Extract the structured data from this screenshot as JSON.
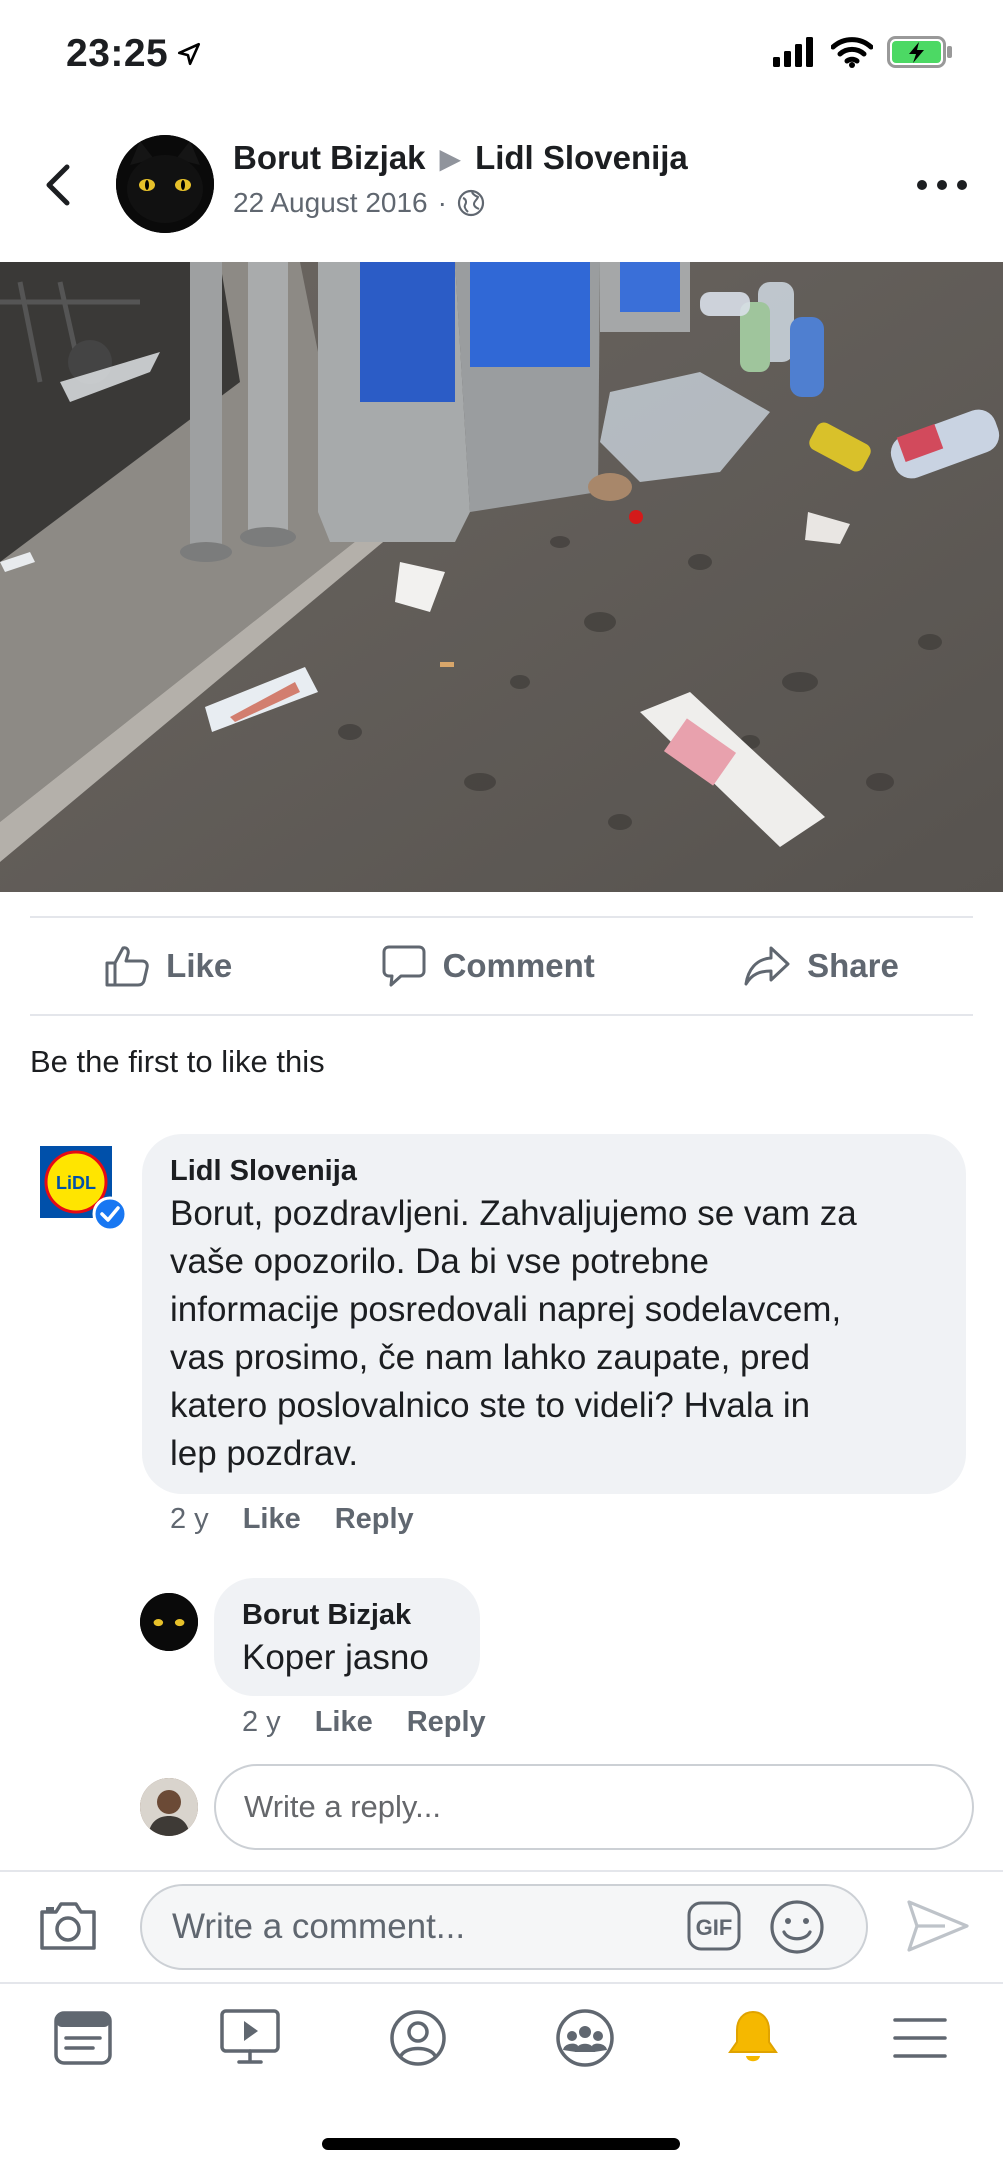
{
  "status_bar": {
    "time": "23:25"
  },
  "post": {
    "author": "Borut Bizjak",
    "target_page": "Lidl Slovenija",
    "date": "22 August 2016",
    "privacy_icon": "globe-icon"
  },
  "actions": {
    "like": "Like",
    "comment": "Comment",
    "share": "Share"
  },
  "likes_summary": "Be the first to like this",
  "comments": [
    {
      "author": "Lidl Slovenija",
      "verified": true,
      "lines": [
        "Borut, pozdravljeni. Zahvaljujemo se vam za",
        "vaše opozorilo. Da bi vse potrebne",
        "informacije posredovali naprej sodelavcem,",
        "vas prosimo, če nam lahko zaupate, pred",
        "katero poslovalnico ste to videli? Hvala in",
        "lep pozdrav."
      ],
      "age": "2 y",
      "like": "Like",
      "reply": "Reply"
    },
    {
      "author": "Borut Bizjak",
      "text": "Koper jasno",
      "age": "2 y",
      "like": "Like",
      "reply": "Reply"
    }
  ],
  "reply_placeholder": "Write a reply...",
  "comment_placeholder": "Write a comment...",
  "gif_label": "GIF",
  "colors": {
    "accent": "#1877f2",
    "bell": "#f5b800",
    "battery": "#4cd964",
    "lidl_blue": "#0050aa",
    "lidl_yellow": "#ffe500",
    "lidl_red": "#e60a14"
  }
}
